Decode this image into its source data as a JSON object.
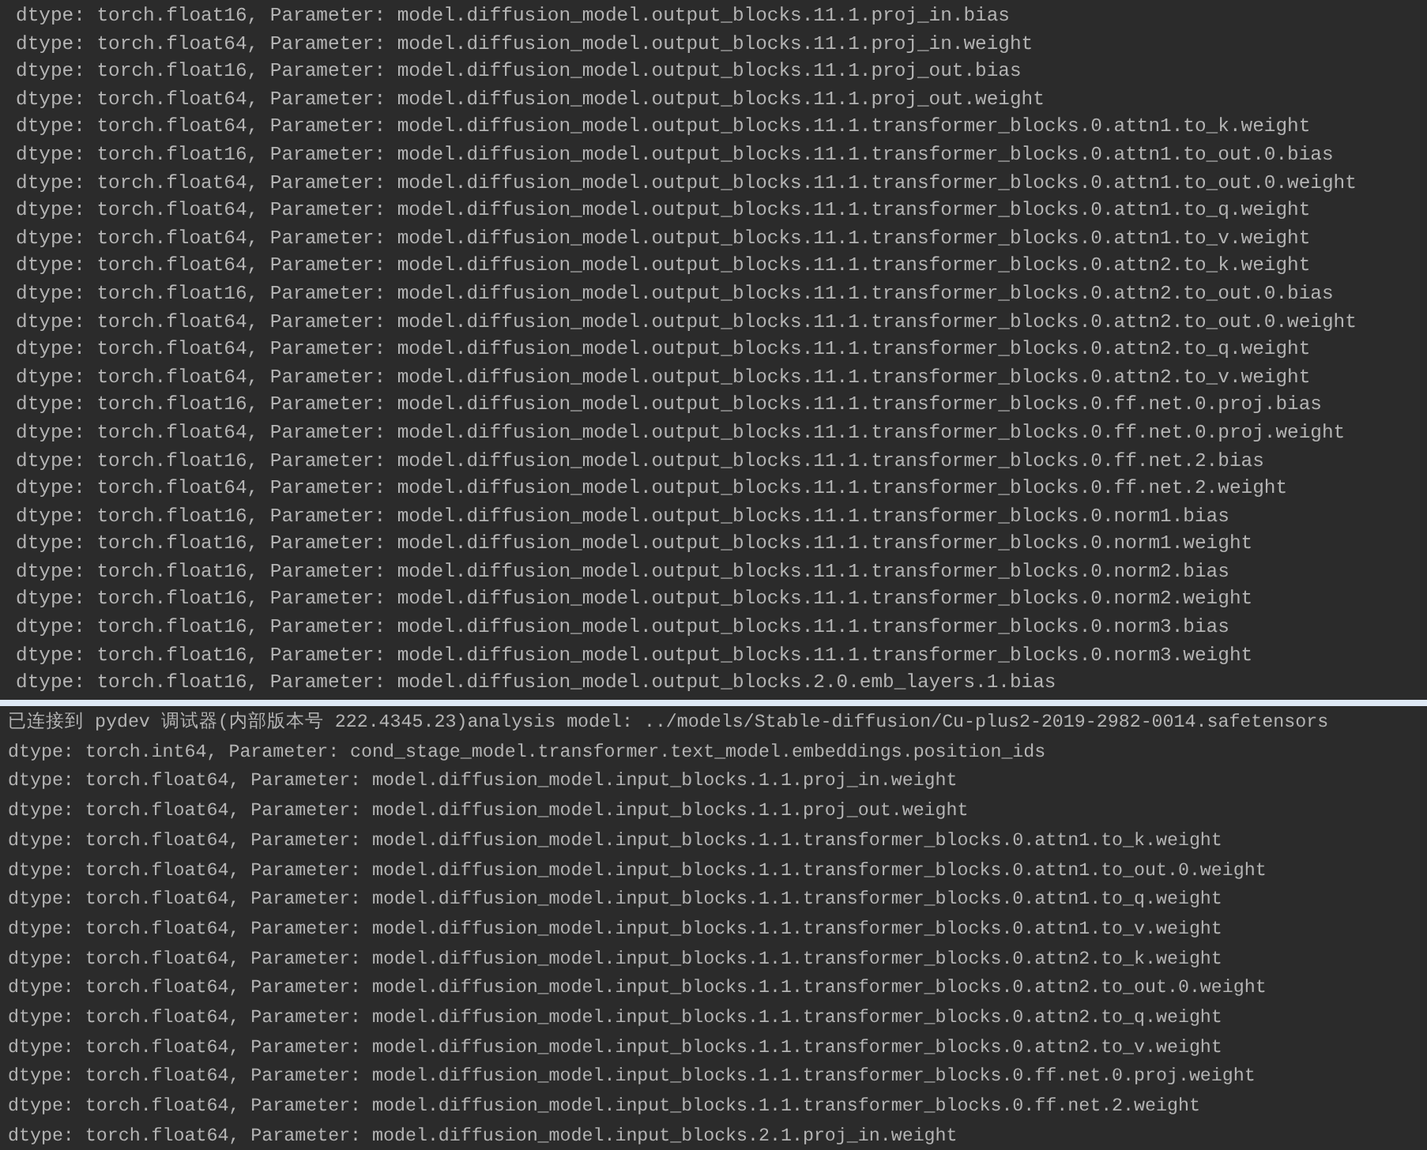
{
  "panels": [
    {
      "lines": [
        "dtype: torch.float16, Parameter: model.diffusion_model.output_blocks.11.1.proj_in.bias",
        "dtype: torch.float64, Parameter: model.diffusion_model.output_blocks.11.1.proj_in.weight",
        "dtype: torch.float16, Parameter: model.diffusion_model.output_blocks.11.1.proj_out.bias",
        "dtype: torch.float64, Parameter: model.diffusion_model.output_blocks.11.1.proj_out.weight",
        "dtype: torch.float64, Parameter: model.diffusion_model.output_blocks.11.1.transformer_blocks.0.attn1.to_k.weight",
        "dtype: torch.float16, Parameter: model.diffusion_model.output_blocks.11.1.transformer_blocks.0.attn1.to_out.0.bias",
        "dtype: torch.float64, Parameter: model.diffusion_model.output_blocks.11.1.transformer_blocks.0.attn1.to_out.0.weight",
        "dtype: torch.float64, Parameter: model.diffusion_model.output_blocks.11.1.transformer_blocks.0.attn1.to_q.weight",
        "dtype: torch.float64, Parameter: model.diffusion_model.output_blocks.11.1.transformer_blocks.0.attn1.to_v.weight",
        "dtype: torch.float64, Parameter: model.diffusion_model.output_blocks.11.1.transformer_blocks.0.attn2.to_k.weight",
        "dtype: torch.float16, Parameter: model.diffusion_model.output_blocks.11.1.transformer_blocks.0.attn2.to_out.0.bias",
        "dtype: torch.float64, Parameter: model.diffusion_model.output_blocks.11.1.transformer_blocks.0.attn2.to_out.0.weight",
        "dtype: torch.float64, Parameter: model.diffusion_model.output_blocks.11.1.transformer_blocks.0.attn2.to_q.weight",
        "dtype: torch.float64, Parameter: model.diffusion_model.output_blocks.11.1.transformer_blocks.0.attn2.to_v.weight",
        "dtype: torch.float16, Parameter: model.diffusion_model.output_blocks.11.1.transformer_blocks.0.ff.net.0.proj.bias",
        "dtype: torch.float64, Parameter: model.diffusion_model.output_blocks.11.1.transformer_blocks.0.ff.net.0.proj.weight",
        "dtype: torch.float16, Parameter: model.diffusion_model.output_blocks.11.1.transformer_blocks.0.ff.net.2.bias",
        "dtype: torch.float64, Parameter: model.diffusion_model.output_blocks.11.1.transformer_blocks.0.ff.net.2.weight",
        "dtype: torch.float16, Parameter: model.diffusion_model.output_blocks.11.1.transformer_blocks.0.norm1.bias",
        "dtype: torch.float16, Parameter: model.diffusion_model.output_blocks.11.1.transformer_blocks.0.norm1.weight",
        "dtype: torch.float16, Parameter: model.diffusion_model.output_blocks.11.1.transformer_blocks.0.norm2.bias",
        "dtype: torch.float16, Parameter: model.diffusion_model.output_blocks.11.1.transformer_blocks.0.norm2.weight",
        "dtype: torch.float16, Parameter: model.diffusion_model.output_blocks.11.1.transformer_blocks.0.norm3.bias",
        "dtype: torch.float16, Parameter: model.diffusion_model.output_blocks.11.1.transformer_blocks.0.norm3.weight",
        "dtype: torch.float16, Parameter: model.diffusion_model.output_blocks.2.0.emb_layers.1.bias"
      ]
    },
    {
      "lines": [
        "已连接到 pydev 调试器(内部版本号 222.4345.23)analysis model: ../models/Stable-diffusion/Cu-plus2-2019-2982-0014.safetensors",
        "dtype: torch.int64, Parameter: cond_stage_model.transformer.text_model.embeddings.position_ids",
        "dtype: torch.float64, Parameter: model.diffusion_model.input_blocks.1.1.proj_in.weight",
        "dtype: torch.float64, Parameter: model.diffusion_model.input_blocks.1.1.proj_out.weight",
        "dtype: torch.float64, Parameter: model.diffusion_model.input_blocks.1.1.transformer_blocks.0.attn1.to_k.weight",
        "dtype: torch.float64, Parameter: model.diffusion_model.input_blocks.1.1.transformer_blocks.0.attn1.to_out.0.weight",
        "dtype: torch.float64, Parameter: model.diffusion_model.input_blocks.1.1.transformer_blocks.0.attn1.to_q.weight",
        "dtype: torch.float64, Parameter: model.diffusion_model.input_blocks.1.1.transformer_blocks.0.attn1.to_v.weight",
        "dtype: torch.float64, Parameter: model.diffusion_model.input_blocks.1.1.transformer_blocks.0.attn2.to_k.weight",
        "dtype: torch.float64, Parameter: model.diffusion_model.input_blocks.1.1.transformer_blocks.0.attn2.to_out.0.weight",
        "dtype: torch.float64, Parameter: model.diffusion_model.input_blocks.1.1.transformer_blocks.0.attn2.to_q.weight",
        "dtype: torch.float64, Parameter: model.diffusion_model.input_blocks.1.1.transformer_blocks.0.attn2.to_v.weight",
        "dtype: torch.float64, Parameter: model.diffusion_model.input_blocks.1.1.transformer_blocks.0.ff.net.0.proj.weight",
        "dtype: torch.float64, Parameter: model.diffusion_model.input_blocks.1.1.transformer_blocks.0.ff.net.2.weight",
        "dtype: torch.float64, Parameter: model.diffusion_model.input_blocks.2.1.proj_in.weight"
      ]
    }
  ]
}
